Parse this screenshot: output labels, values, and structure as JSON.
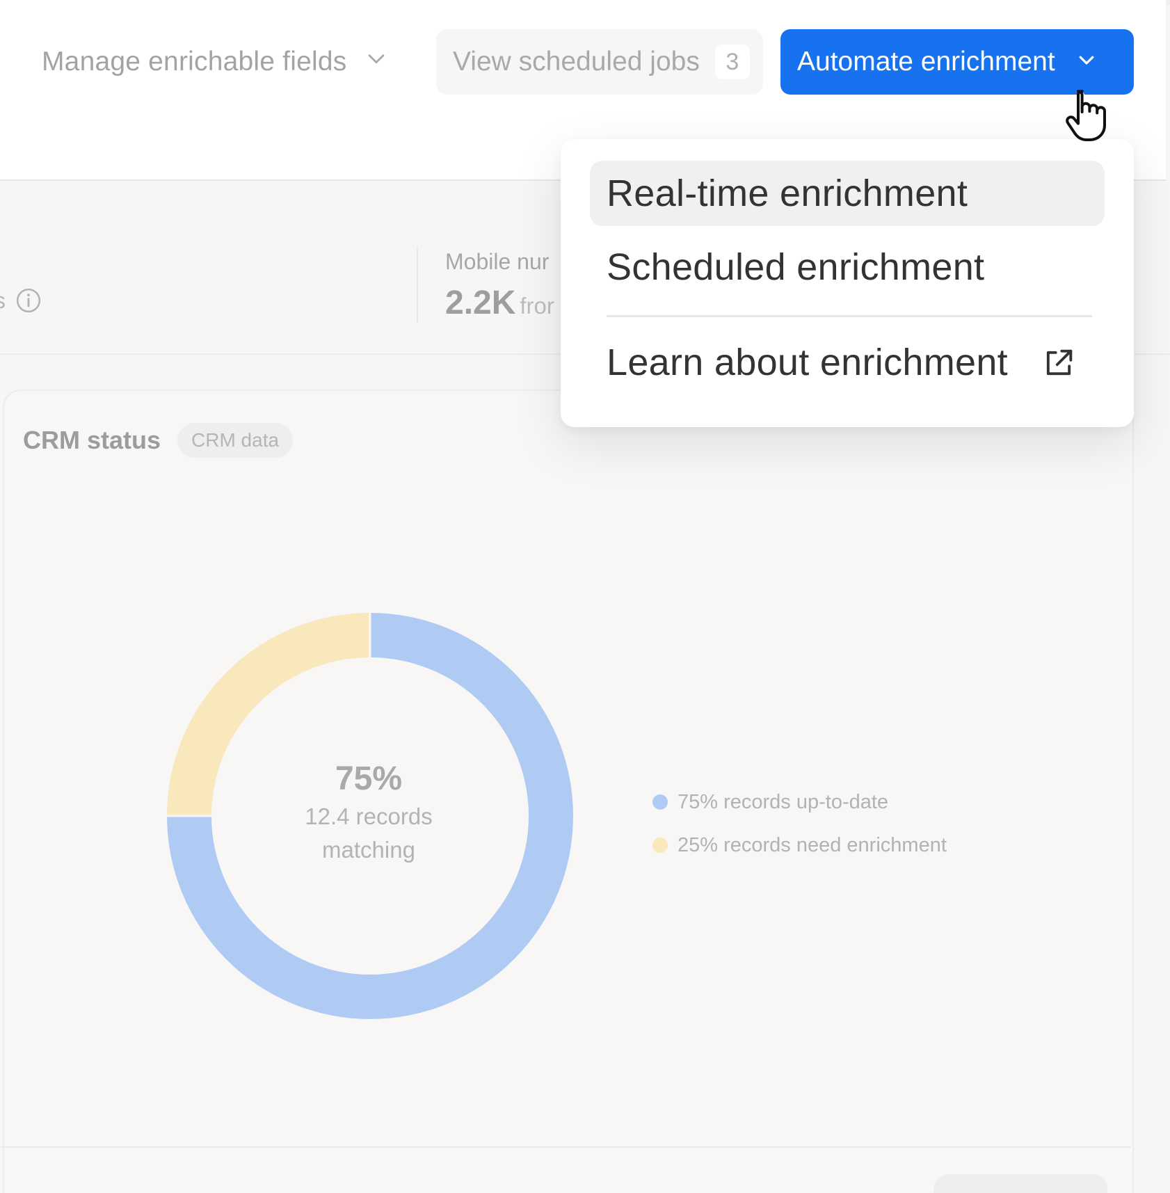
{
  "toolbar": {
    "manage_label": "Manage enrichable fields",
    "jobs_label": "View scheduled jobs",
    "jobs_count": "3",
    "automate_label": "Automate enrichment"
  },
  "menu": {
    "items": [
      {
        "label": "Real-time enrichment",
        "highlighted": true
      },
      {
        "label": "Scheduled enrichment",
        "highlighted": false
      },
      {
        "label": "Learn about enrichment",
        "external": true
      }
    ]
  },
  "stats": {
    "partial_left": "s",
    "mobile_label": "Mobile nur",
    "mobile_value": "2.2K",
    "mobile_sub": "fror"
  },
  "card": {
    "title": "CRM status",
    "badge": "CRM data",
    "center_pct": "75%",
    "center_line1": "12.4 records",
    "center_line2": "matching"
  },
  "chart_data": {
    "type": "pie",
    "categories": [
      "records up-to-date",
      "records need enrichment"
    ],
    "values": [
      75,
      25
    ],
    "legend": [
      "75% records up-to-date",
      "25% records need enrichment"
    ],
    "colors": [
      "#b0cbf3",
      "#f8e8bb"
    ],
    "legend_position": "right"
  },
  "colors": {
    "accent": "#1772f0",
    "up_to_date": "#b0cbf3",
    "need_enrichment": "#f8e8bb"
  },
  "icons": {
    "manage_chevron": "chevron-down-icon",
    "automate_chevron": "chevron-down-icon",
    "external": "external-link-icon",
    "info": "info-icon",
    "cursor": "hand-cursor-icon"
  }
}
